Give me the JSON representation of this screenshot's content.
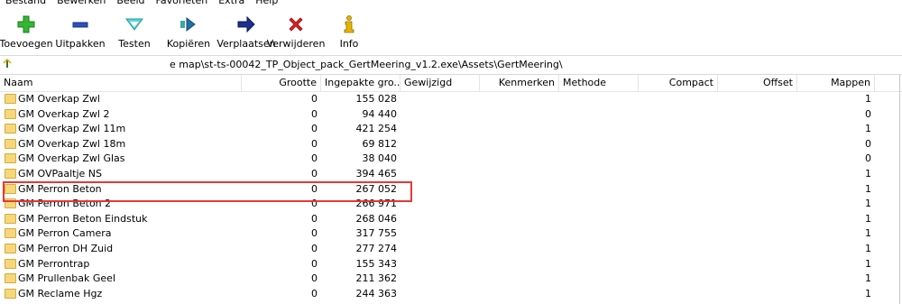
{
  "menu": [
    "Bestand",
    "Bewerken",
    "Beeld",
    "Favorieten",
    "Extra",
    "Help"
  ],
  "toolbar": [
    {
      "label": "Toevoegen",
      "icon": "add-icon"
    },
    {
      "label": "Uitpakken",
      "icon": "extract-icon"
    },
    {
      "label": "Testen",
      "icon": "test-icon"
    },
    {
      "label": "Kopiëren",
      "icon": "copy-icon"
    },
    {
      "label": "Verplaatsen",
      "icon": "move-icon"
    },
    {
      "label": "Verwijderen",
      "icon": "delete-icon"
    },
    {
      "label": "Info",
      "icon": "info-icon"
    }
  ],
  "address": {
    "path": "e map\\st-ts-00042_TP_Object_pack_GertMeering_v1.2.exe\\Assets\\GertMeering\\"
  },
  "columns": {
    "name": "Naam",
    "size": "Grootte",
    "packed": "Ingepakte gro...",
    "modified": "Gewijzigd",
    "attributes": "Kenmerken",
    "method": "Methode",
    "compact": "Compact",
    "offset": "Offset",
    "folders": "Mappen"
  },
  "rows": [
    {
      "name": "GM Overkap Zwl",
      "size": "0",
      "packed": "155 028",
      "folders": "1"
    },
    {
      "name": "GM Overkap Zwl 2",
      "size": "0",
      "packed": "94 440",
      "folders": "0"
    },
    {
      "name": "GM Overkap Zwl 11m",
      "size": "0",
      "packed": "421 254",
      "folders": "1"
    },
    {
      "name": "GM Overkap Zwl 18m",
      "size": "0",
      "packed": "69 812",
      "folders": "0"
    },
    {
      "name": "GM Overkap Zwl Glas",
      "size": "0",
      "packed": "38 040",
      "folders": "0"
    },
    {
      "name": "GM OVPaaltje NS",
      "size": "0",
      "packed": "394 465",
      "folders": "1"
    },
    {
      "name": "GM Perron Beton",
      "size": "0",
      "packed": "267 052",
      "folders": "1"
    },
    {
      "name": "GM Perron Beton 2",
      "size": "0",
      "packed": "266 971",
      "folders": "1"
    },
    {
      "name": "GM Perron Beton Eindstuk",
      "size": "0",
      "packed": "268 046",
      "folders": "1"
    },
    {
      "name": "GM Perron Camera",
      "size": "0",
      "packed": "317 755",
      "folders": "1"
    },
    {
      "name": "GM Perron DH Zuid",
      "size": "0",
      "packed": "277 274",
      "folders": "1"
    },
    {
      "name": "GM Perrontrap",
      "size": "0",
      "packed": "155 343",
      "folders": "1"
    },
    {
      "name": "GM Prullenbak Geel",
      "size": "0",
      "packed": "211 362",
      "folders": "1"
    },
    {
      "name": "GM Reclame Hgz",
      "size": "0",
      "packed": "244 363",
      "folders": "1"
    }
  ],
  "colors": {
    "highlight": "#e53935",
    "folder": "#f6d77a"
  }
}
